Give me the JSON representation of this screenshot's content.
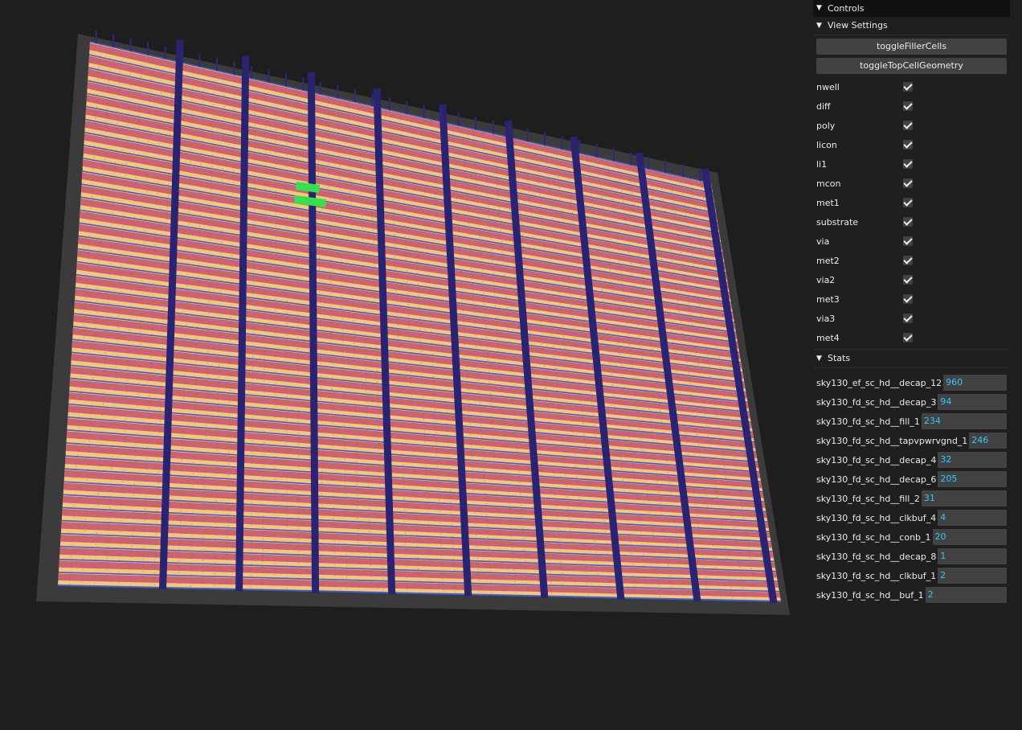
{
  "gui": {
    "title": "Controls",
    "view_settings": {
      "title": "View Settings",
      "buttons": [
        "toggleFillerCells",
        "toggleTopCellGeometry"
      ],
      "layers": [
        {
          "label": "nwell",
          "checked": true
        },
        {
          "label": "diff",
          "checked": true
        },
        {
          "label": "poly",
          "checked": true
        },
        {
          "label": "licon",
          "checked": true
        },
        {
          "label": "li1",
          "checked": true
        },
        {
          "label": "mcon",
          "checked": true
        },
        {
          "label": "met1",
          "checked": true
        },
        {
          "label": "substrate",
          "checked": true
        },
        {
          "label": "via",
          "checked": true
        },
        {
          "label": "met2",
          "checked": true
        },
        {
          "label": "via2",
          "checked": true
        },
        {
          "label": "met3",
          "checked": true
        },
        {
          "label": "via3",
          "checked": true
        },
        {
          "label": "met4",
          "checked": true
        }
      ]
    },
    "stats": {
      "title": "Stats",
      "items": [
        {
          "label": "sky130_ef_sc_hd__decap_12",
          "value": "960"
        },
        {
          "label": "sky130_fd_sc_hd__decap_3",
          "value": "94"
        },
        {
          "label": "sky130_fd_sc_hd__fill_1",
          "value": "234"
        },
        {
          "label": "sky130_fd_sc_hd__tapvpwrvgnd_1",
          "value": "246"
        },
        {
          "label": "sky130_fd_sc_hd__decap_4",
          "value": "32"
        },
        {
          "label": "sky130_fd_sc_hd__decap_6",
          "value": "205"
        },
        {
          "label": "sky130_fd_sc_hd__fill_2",
          "value": "31"
        },
        {
          "label": "sky130_fd_sc_hd__clkbuf_4",
          "value": "4"
        },
        {
          "label": "sky130_fd_sc_hd__conb_1",
          "value": "20"
        },
        {
          "label": "sky130_fd_sc_hd__decap_8",
          "value": "1"
        },
        {
          "label": "sky130_fd_sc_hd__clkbuf_1",
          "value": "2"
        },
        {
          "label": "sky130_fd_sc_hd__buf_1",
          "value": "2"
        }
      ]
    }
  },
  "scene": {
    "colors": {
      "background": "#1e1e1e",
      "substrate": "#3b3b3b",
      "cell_fill": "#f2c77a",
      "cell_row": "#c7506e",
      "rail": "#3a5fd6",
      "strap": "#2a2470",
      "selection": "#33e04d"
    },
    "row_count": 42,
    "strap_count": 9,
    "selected_cells": 2
  }
}
